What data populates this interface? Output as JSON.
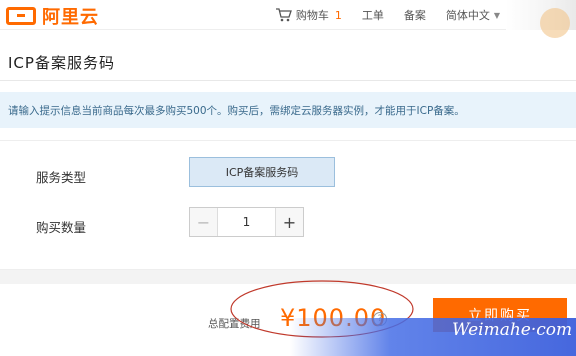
{
  "header": {
    "logo_text": "阿里云",
    "nav": {
      "cart_label": "购物车",
      "cart_count": "1",
      "ticket_label": "工单",
      "filing_label": "备案",
      "language_label": "简体中文"
    }
  },
  "page": {
    "title": "ICP备案服务码"
  },
  "notice": {
    "text": "请输入提示信息当前商品每次最多购买500个。购买后，需绑定云服务器实例，才能用于ICP备案。"
  },
  "form": {
    "service_type_label": "服务类型",
    "service_type_value": "ICP备案服务码",
    "quantity_label": "购买数量",
    "quantity_value": "1",
    "minus_symbol": "−",
    "plus_symbol": "+"
  },
  "footer": {
    "total_label": "总配置费用",
    "price": "¥100.00",
    "help_symbol": "?",
    "buy_button_label": "立即购买"
  },
  "watermark": {
    "text": "Weimahe·com"
  },
  "colors": {
    "brand": "#ff6a00",
    "notice_bg": "#e8f3fb",
    "selected_option_bg": "#dbe9f6",
    "annotation_ellipse": "#c0392b"
  }
}
